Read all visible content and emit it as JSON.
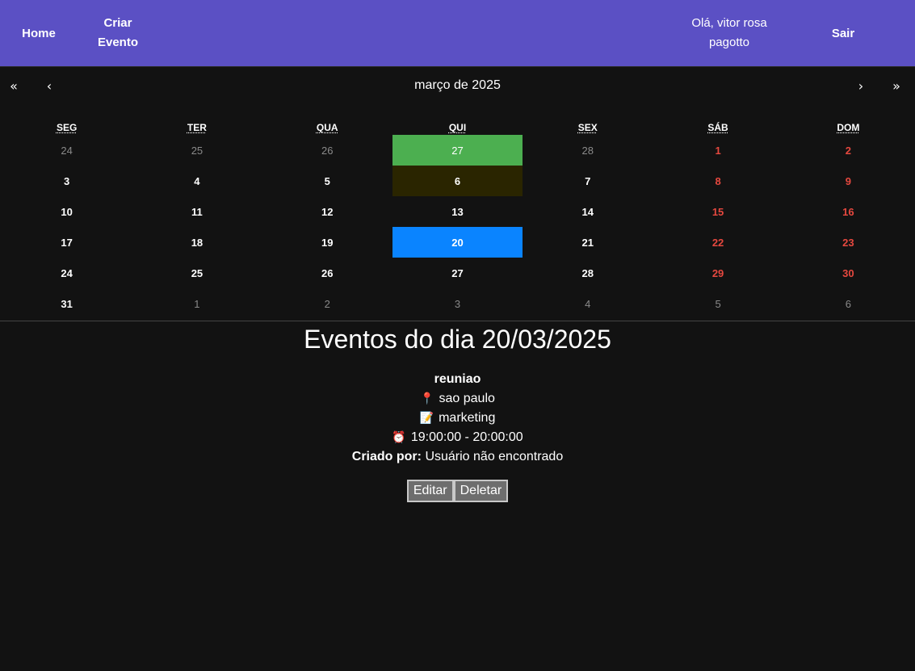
{
  "nav": {
    "home": "Home",
    "create_event": "Criar\nEvento",
    "greeting": "Olá, vitor rosa pagotto",
    "logout": "Sair"
  },
  "calendar": {
    "prev_year": "«",
    "prev_month": "‹",
    "title": "março de 2025",
    "next_month": "›",
    "next_year": "»",
    "weekdays": [
      "SEG",
      "TER",
      "QUA",
      "QUI",
      "SEX",
      "SÁB",
      "DOM"
    ],
    "weeks": [
      [
        "24",
        "25",
        "26",
        "27",
        "28",
        "1",
        "2"
      ],
      [
        "3",
        "4",
        "5",
        "6",
        "7",
        "8",
        "9"
      ],
      [
        "10",
        "11",
        "12",
        "13",
        "14",
        "15",
        "16"
      ],
      [
        "17",
        "18",
        "19",
        "20",
        "21",
        "22",
        "23"
      ],
      [
        "24",
        "25",
        "26",
        "27",
        "28",
        "29",
        "30"
      ],
      [
        "31",
        "1",
        "2",
        "3",
        "4",
        "5",
        "6"
      ]
    ],
    "colors": {
      "today": "#4caf50",
      "selected": "#0a84ff",
      "highlight": "#2a2500",
      "weekend": "#e5483f",
      "neighbor": "#8a8a8a"
    }
  },
  "events": {
    "heading": "Eventos do dia 20/03/2025",
    "items": [
      {
        "name": "reuniao",
        "location_icon": "pin-icon",
        "location": "sao paulo",
        "description_icon": "memo-icon",
        "description": "marketing",
        "time_icon": "alarm-clock-icon",
        "time": "19:00:00 - 20:00:00",
        "creator_label": "Criado por:",
        "creator": "Usuário não encontrado",
        "edit_label": "Editar",
        "delete_label": "Deletar"
      }
    ]
  }
}
